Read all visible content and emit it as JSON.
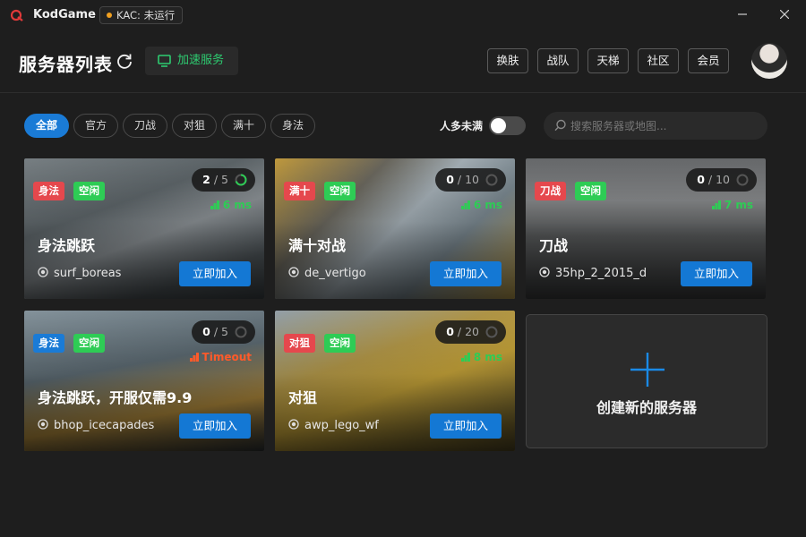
{
  "app": {
    "name": "KodGame",
    "kac_status": "KAC: 未运行"
  },
  "header": {
    "title": "服务器列表",
    "accelerate_label": "加速服务",
    "nav": [
      "换肤",
      "战队",
      "天梯",
      "社区",
      "会员"
    ]
  },
  "filters": {
    "chips": [
      "全部",
      "官方",
      "刀战",
      "对狙",
      "满十",
      "身法"
    ],
    "active": "全部",
    "toggle_label": "人多未满",
    "toggle_on": false,
    "search_placeholder": "搜索服务器或地图..."
  },
  "servers": [
    {
      "tags": [
        {
          "text": "身法",
          "color": "#e5484d"
        },
        {
          "text": "空闲",
          "color": "#2ecc55"
        }
      ],
      "players": "2",
      "capacity": "/ 5",
      "ping": "6 ms",
      "title": "身法跳跃",
      "map": "surf_boreas",
      "join": "立即加入"
    },
    {
      "tags": [
        {
          "text": "满十",
          "color": "#e5484d"
        },
        {
          "text": "空闲",
          "color": "#2ecc55"
        }
      ],
      "players": "0",
      "capacity": "/ 10",
      "ping": "6 ms",
      "title": "满十对战",
      "map": "de_vertigo",
      "join": "立即加入"
    },
    {
      "tags": [
        {
          "text": "刀战",
          "color": "#e5484d"
        },
        {
          "text": "空闲",
          "color": "#2ecc55"
        }
      ],
      "players": "0",
      "capacity": "/ 10",
      "ping": "7 ms",
      "title": "刀战",
      "map": "35hp_2_2015_d",
      "join": "立即加入"
    },
    {
      "tags": [
        {
          "text": "身法",
          "color": "#1a7bd6"
        },
        {
          "text": "空闲",
          "color": "#2ecc55"
        }
      ],
      "players": "0",
      "capacity": "/ 5",
      "ping": "Timeout",
      "title": "身法跳跃，开服仅需9.9",
      "map": "bhop_icecapades",
      "join": "立即加入"
    },
    {
      "tags": [
        {
          "text": "对狙",
          "color": "#e5484d"
        },
        {
          "text": "空闲",
          "color": "#2ecc55"
        }
      ],
      "players": "0",
      "capacity": "/ 20",
      "ping": "8 ms",
      "title": "对狙",
      "map": "awp_lego_wf",
      "join": "立即加入"
    }
  ],
  "create": {
    "label": "创建新的服务器"
  },
  "colors": {
    "accent": "#1a7bd6",
    "green": "#2ecc55",
    "red": "#e5484d",
    "timeout": "#ff5a2a"
  }
}
